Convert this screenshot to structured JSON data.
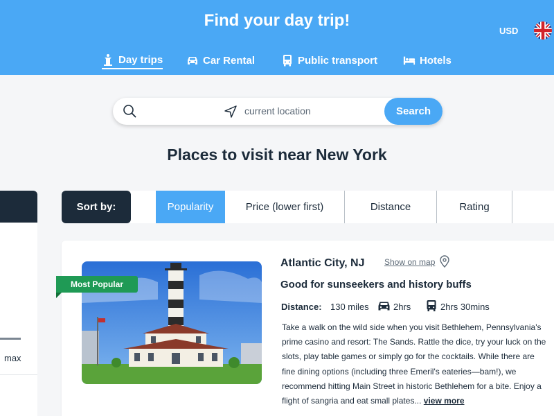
{
  "header": {
    "title": "Find your day trip!",
    "currency": "USD",
    "language_flag": "uk-flag-icon",
    "colors": {
      "brand": "#4aa8f5",
      "dark": "#1c2b3a",
      "badge": "#1f9a55"
    }
  },
  "nav": {
    "items": [
      {
        "label": "Day trips",
        "icon": "day-trips-icon",
        "active": true
      },
      {
        "label": "Car Rental",
        "icon": "car-icon",
        "active": false
      },
      {
        "label": "Public transport",
        "icon": "bus-icon",
        "active": false
      },
      {
        "label": "Hotels",
        "icon": "bed-icon",
        "active": false
      }
    ]
  },
  "search": {
    "placeholder": "current location",
    "button_label": "Search"
  },
  "section": {
    "title": "Places to visit near New York"
  },
  "filters": {
    "max_label": "max"
  },
  "sort": {
    "label": "Sort by:",
    "options": [
      {
        "label": "Popularity",
        "active": true
      },
      {
        "label": "Price (lower first)",
        "active": false
      },
      {
        "label": "Distance",
        "active": false
      },
      {
        "label": "Rating",
        "active": false
      }
    ]
  },
  "results": [
    {
      "badge": "Most Popular",
      "name": "Atlantic City, NJ",
      "map_link": "Show on map",
      "tagline": "Good for sunseekers and history buffs",
      "distance_label": "Distance:",
      "distance": "130 miles",
      "car_time": "2hrs",
      "transit_time": "2hrs 30mins",
      "description_lines": [
        "Take a walk on the wild side when you visit Bethlehem, Pennsylvania's",
        "prime casino and resort: The Sands. Rattle the dice, try your luck on the",
        "slots, play table games or simply go for the cocktails. While there are",
        "fine dining options (including three Emeril's eateries—bam!), we",
        "recommend hitting Main Street in historic Bethlehem for a bite. Enjoy a",
        "flight of sangria and eat small plates..."
      ],
      "view_more": "view more"
    }
  ]
}
